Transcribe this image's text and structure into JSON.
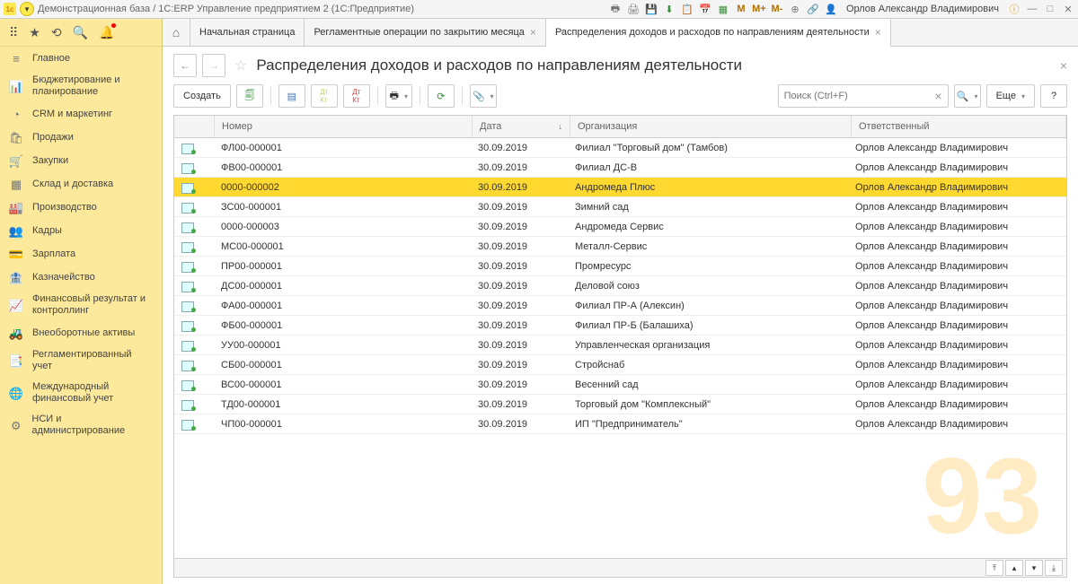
{
  "titlebar": "Демонстрационная база / 1С:ERP Управление предприятием 2  (1С:Предприятие)",
  "user": "Орлов Александр Владимирович",
  "top_labels": {
    "m": "M",
    "mp": "M+",
    "mm": "M-"
  },
  "sidebar": [
    {
      "icon": "≡",
      "label": "Главное"
    },
    {
      "icon": "📊",
      "label": "Бюджетирование и планирование"
    },
    {
      "icon": "◔",
      "label": "CRM и маркетинг"
    },
    {
      "icon": "🛍",
      "label": "Продажи"
    },
    {
      "icon": "🛒",
      "label": "Закупки"
    },
    {
      "icon": "▦",
      "label": "Склад и доставка"
    },
    {
      "icon": "🏭",
      "label": "Производство"
    },
    {
      "icon": "👥",
      "label": "Кадры"
    },
    {
      "icon": "💳",
      "label": "Зарплата"
    },
    {
      "icon": "🏦",
      "label": "Казначейство"
    },
    {
      "icon": "📈",
      "label": "Финансовый результат и контроллинг"
    },
    {
      "icon": "🚜",
      "label": "Внеоборотные активы"
    },
    {
      "icon": "📑",
      "label": "Регламентированный учет"
    },
    {
      "icon": "🌐",
      "label": "Международный финансовый учет"
    },
    {
      "icon": "⚙",
      "label": "НСИ и администрирование"
    }
  ],
  "tabs": [
    {
      "label": "Начальная страница",
      "close": false
    },
    {
      "label": "Регламентные операции по закрытию месяца",
      "close": true
    },
    {
      "label": "Распределения доходов и расходов по направлениям деятельности",
      "close": true,
      "active": true
    }
  ],
  "page_title": "Распределения доходов и расходов по направлениям деятельности",
  "toolbar": {
    "create": "Создать",
    "more": "Еще",
    "search_ph": "Поиск (Ctrl+F)"
  },
  "columns": {
    "num": "Номер",
    "date": "Дата",
    "org": "Организация",
    "resp": "Ответственный"
  },
  "rows": [
    {
      "num": "ФЛ00-000001",
      "date": "30.09.2019",
      "org": "Филиал \"Торговый дом\" (Тамбов)",
      "resp": "Орлов Александр Владимирович"
    },
    {
      "num": "ФВ00-000001",
      "date": "30.09.2019",
      "org": "Филиал ДС-В",
      "resp": "Орлов Александр Владимирович"
    },
    {
      "num": "0000-000002",
      "date": "30.09.2019",
      "org": "Андромеда Плюс",
      "resp": "Орлов Александр Владимирович",
      "sel": true
    },
    {
      "num": "ЗС00-000001",
      "date": "30.09.2019",
      "org": "Зимний сад",
      "resp": "Орлов Александр Владимирович"
    },
    {
      "num": "0000-000003",
      "date": "30.09.2019",
      "org": "Андромеда Сервис",
      "resp": "Орлов Александр Владимирович"
    },
    {
      "num": "МС00-000001",
      "date": "30.09.2019",
      "org": "Металл-Сервис",
      "resp": "Орлов Александр Владимирович"
    },
    {
      "num": "ПР00-000001",
      "date": "30.09.2019",
      "org": "Промресурс",
      "resp": "Орлов Александр Владимирович"
    },
    {
      "num": "ДС00-000001",
      "date": "30.09.2019",
      "org": "Деловой союз",
      "resp": "Орлов Александр Владимирович"
    },
    {
      "num": "ФА00-000001",
      "date": "30.09.2019",
      "org": "Филиал ПР-А (Алексин)",
      "resp": "Орлов Александр Владимирович"
    },
    {
      "num": "ФБ00-000001",
      "date": "30.09.2019",
      "org": "Филиал ПР-Б (Балашиха)",
      "resp": "Орлов Александр Владимирович"
    },
    {
      "num": "УУ00-000001",
      "date": "30.09.2019",
      "org": "Управленческая организация",
      "resp": "Орлов Александр Владимирович"
    },
    {
      "num": "СБ00-000001",
      "date": "30.09.2019",
      "org": "Стройснаб",
      "resp": "Орлов Александр Владимирович"
    },
    {
      "num": "ВС00-000001",
      "date": "30.09.2019",
      "org": "Весенний сад",
      "resp": "Орлов Александр Владимирович"
    },
    {
      "num": "ТД00-000001",
      "date": "30.09.2019",
      "org": "Торговый дом \"Комплексный\"",
      "resp": "Орлов Александр Владимирович"
    },
    {
      "num": "ЧП00-000001",
      "date": "30.09.2019",
      "org": "ИП \"Предприниматель\"",
      "resp": "Орлов Александр Владимирович"
    }
  ]
}
